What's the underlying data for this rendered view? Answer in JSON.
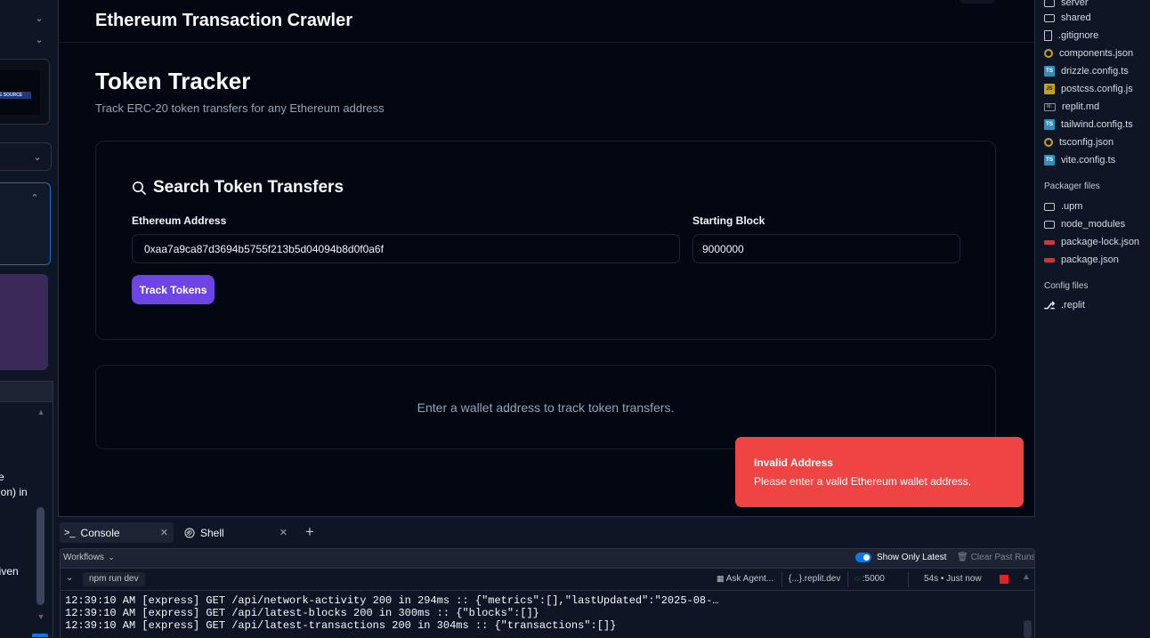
{
  "left_strip": {
    "thumb_text": "E SOURCE",
    "text_lines": [
      "e",
      "ion) in",
      "given"
    ]
  },
  "app": {
    "title": "Ethereum Transaction Crawler",
    "page_title": "Token Tracker",
    "page_subtitle": "Track ERC-20 token transfers for any Ethereum address",
    "search_card": {
      "title": "Search Token Transfers",
      "address_label": "Ethereum Address",
      "address_value": "0xaa7a9ca87d3694b5755f213b5d04094b8d0f0a6f",
      "block_label": "Starting Block",
      "block_value": "9000000",
      "button_label": "Track Tokens"
    },
    "empty_message": "Enter a wallet address to track token transfers.",
    "toast": {
      "title": "Invalid Address",
      "message": "Please enter a valid Ethereum wallet address."
    },
    "colors": {
      "primary": "#6d45e4",
      "destructive": "#ef4444",
      "background": "#030711"
    }
  },
  "file_tree": {
    "files": [
      {
        "name": "server",
        "icon": "folder-icon"
      },
      {
        "name": "shared",
        "icon": "folder-icon"
      },
      {
        "name": ".gitignore",
        "icon": "file-icon"
      },
      {
        "name": "components.json",
        "icon": "json-icon"
      },
      {
        "name": "drizzle.config.ts",
        "icon": "ts-icon"
      },
      {
        "name": "postcss.config.js",
        "icon": "js-icon"
      },
      {
        "name": "replit.md",
        "icon": "markdown-icon"
      },
      {
        "name": "tailwind.config.ts",
        "icon": "ts-icon"
      },
      {
        "name": "tsconfig.json",
        "icon": "json-icon"
      },
      {
        "name": "vite.config.ts",
        "icon": "ts-icon"
      }
    ],
    "packager_title": "Packager files",
    "packager_files": [
      {
        "name": ".upm",
        "icon": "folder-icon"
      },
      {
        "name": "node_modules",
        "icon": "folder-icon"
      },
      {
        "name": "package-lock.json",
        "icon": "npm-icon"
      },
      {
        "name": "package.json",
        "icon": "npm-icon"
      }
    ],
    "config_title": "Config files",
    "config_files": [
      {
        "name": ".replit",
        "icon": "replit-icon"
      }
    ]
  },
  "bottom": {
    "tabs": [
      {
        "label": "Console",
        "icon": ">_"
      },
      {
        "label": "Shell",
        "icon": "shell-icon"
      }
    ],
    "workflows_label": "Workflows",
    "show_latest_label": "Show Only Latest",
    "clear_runs_label": "Clear Past Runs",
    "run_command": "npm run dev",
    "ask_agent_label": "Ask Agent...",
    "domain_label": "{...}.replit.dev",
    "port_label": ":5000",
    "run_status": "54s • Just now",
    "logs": [
      "12:39:10 AM [express] GET /api/network-activity 200 in 294ms :: {\"metrics\":[],\"lastUpdated\":\"2025-08-…",
      "12:39:10 AM [express] GET /api/latest-blocks 200 in 300ms :: {\"blocks\":[]}",
      "12:39:10 AM [express] GET /api/latest-transactions 200 in 304ms :: {\"transactions\":[]}"
    ]
  }
}
